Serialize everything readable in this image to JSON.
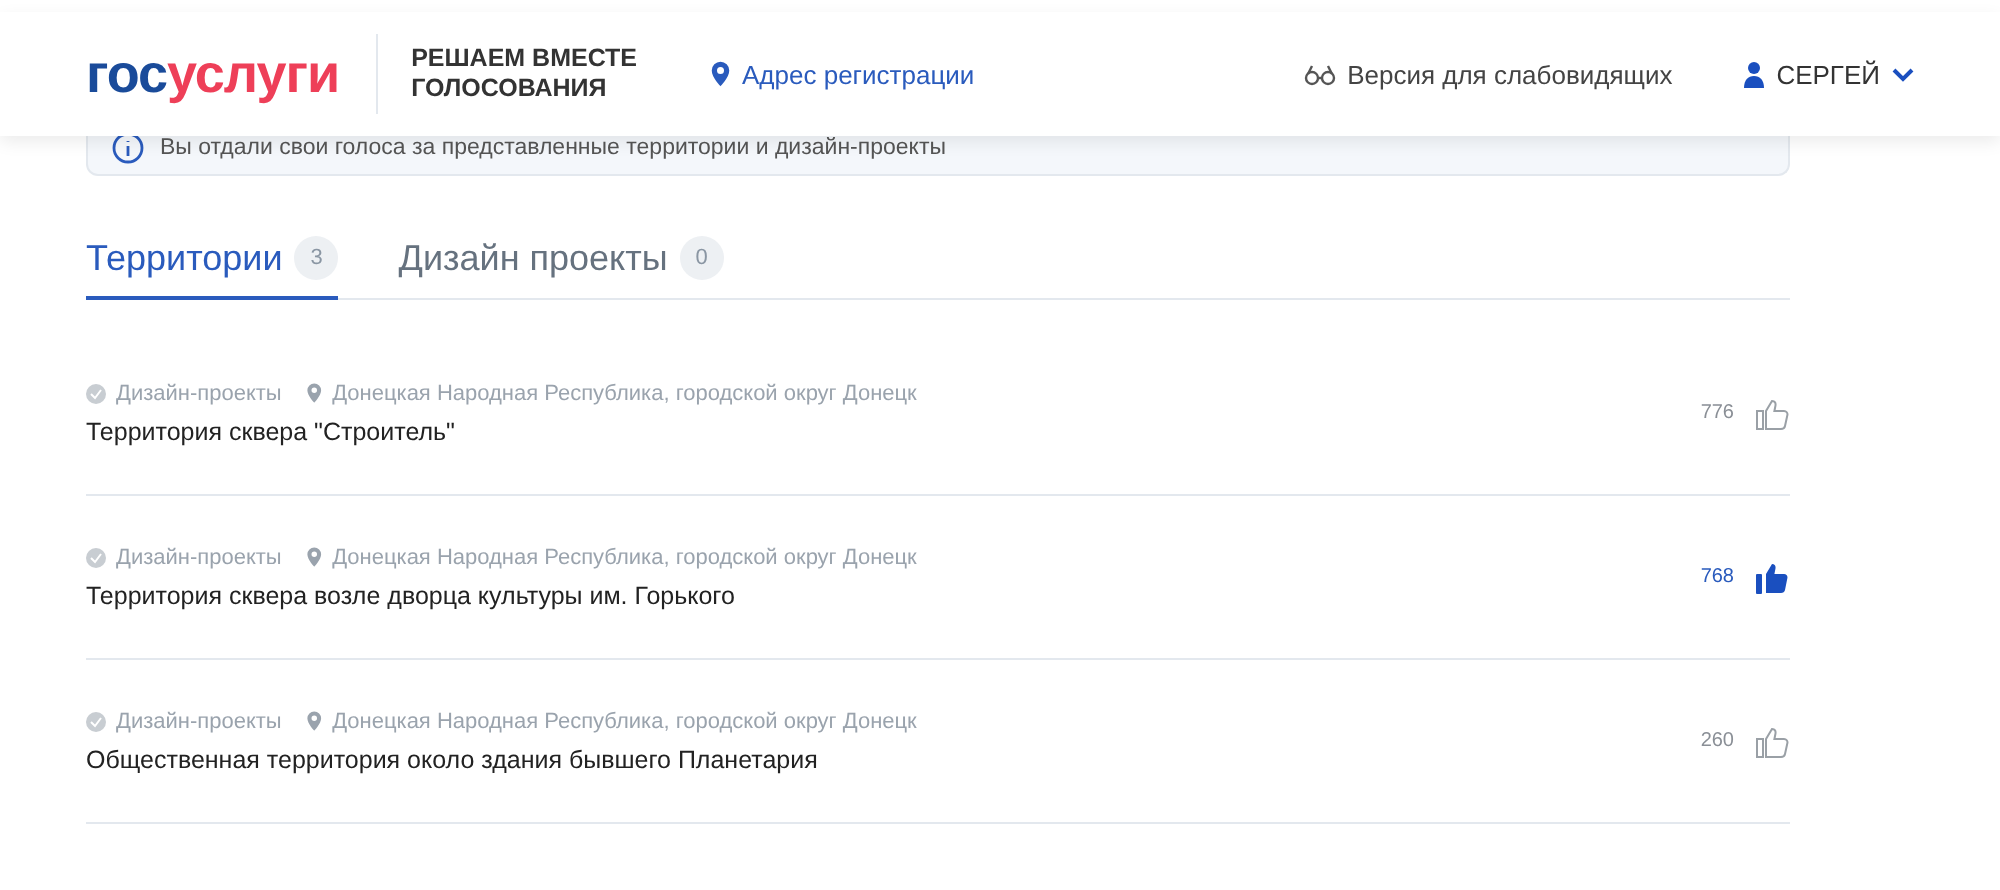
{
  "header": {
    "logo": {
      "part_1": "гос",
      "part_2": "услуги"
    },
    "project_title": "РЕШАЕМ ВМЕСТЕ\nГОЛОСОВАНИЯ",
    "address_link": "Адрес регистрации",
    "accessibility_link": "Версия для слабовидящих",
    "user": "СЕРГЕЙ"
  },
  "notice": "Вы отдали свои голоса за представленные территории и дизайн-проекты",
  "tabs": [
    {
      "label": "Территории",
      "count": "3",
      "selected": true
    },
    {
      "label": "Дизайн проекты",
      "count": "0",
      "selected": false
    }
  ],
  "items": [
    {
      "category": "Дизайн-проекты",
      "location": "Донецкая Народная Республика, городской округ Донецк",
      "title": "Территория сквера \"Строитель\"",
      "votes": "776",
      "liked": false
    },
    {
      "category": "Дизайн-проекты",
      "location": "Донецкая Народная Республика, городской округ Донецк",
      "title": "Территория сквера возле дворца культуры им. Горького",
      "votes": "768",
      "liked": true
    },
    {
      "category": "Дизайн-проекты",
      "location": "Донецкая Народная Республика, городской округ Донецк",
      "title": "Общественная территория около здания бывшего Планетария",
      "votes": "260",
      "liked": false
    }
  ]
}
